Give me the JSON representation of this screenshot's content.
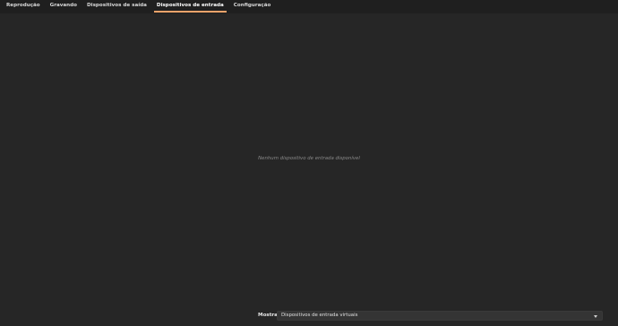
{
  "tabs": [
    {
      "label": "Reprodução",
      "active": false
    },
    {
      "label": "Gravando",
      "active": false
    },
    {
      "label": "Dispositivos de saída",
      "active": false
    },
    {
      "label": "Dispositivos de entrada",
      "active": true
    },
    {
      "label": "Configuração",
      "active": false
    }
  ],
  "main": {
    "empty_message": "Nenhum dispositivo de entrada disponível"
  },
  "footer": {
    "show_label": "Mostrar:",
    "show_value": "Dispositivos de entrada virtuais",
    "dropdown_icon": "chevron-down-icon"
  },
  "colors": {
    "background": "#262626",
    "tabbar": "#1f1f1f",
    "accent": "#f0a36a",
    "muted_text": "#8a8a8a"
  }
}
